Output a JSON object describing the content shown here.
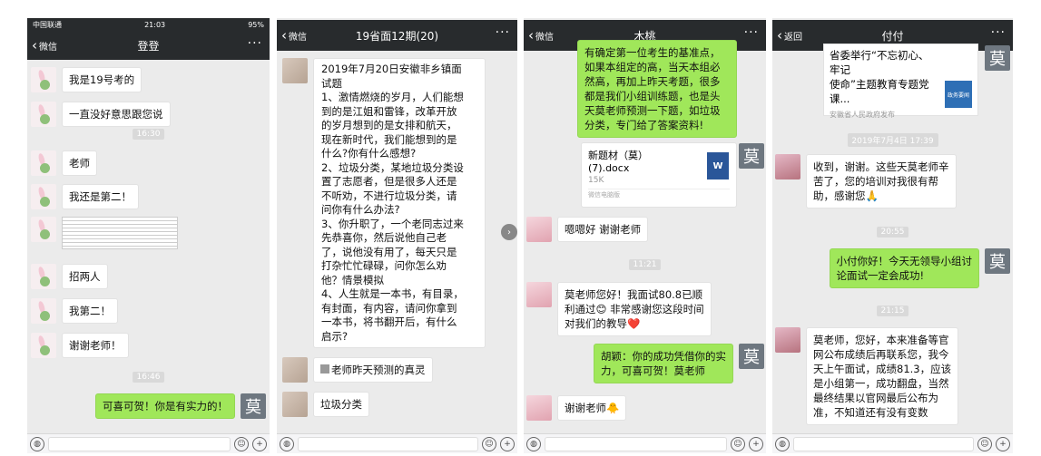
{
  "panel1": {
    "status": {
      "carrier": "中国联通",
      "time": "21:03",
      "battery": "95%"
    },
    "back_label": "微信",
    "title": "登登",
    "messages": [
      "我是19号考的",
      "一直没好意思跟您说",
      "老师",
      "我还是第二！",
      "招两人",
      "我第二！",
      "谢谢老师！"
    ],
    "times": [
      "16:30",
      "16:46"
    ],
    "reply": "可喜可贺！你是有实力的！",
    "avatar_char": "莫"
  },
  "panel2": {
    "back_label": "微信",
    "title": "19省面12期(20)",
    "question_lines": [
      "2019年7月20日安徽非乡镇面",
      "试题",
      "1、激情燃烧的岁月，人们能想",
      "到的是江姐和雷锋，改革开放",
      "的岁月想到的是女排和航天，",
      "现在新时代，我们能想到的是",
      "什么?你有什么感想?",
      "2、垃圾分类，某地垃圾分类设",
      "置了志愿者，但是很多人还是",
      "不听劝，不进行垃圾分类，请",
      "问你有什么办法?",
      "3、你升职了，一个老同志过来",
      "先恭喜你，然后说他自己老",
      "了，说他没有用了，每天只是",
      "打杂忙忙碌碌，问你怎么劝",
      "他？情景模拟",
      "4、人生就是一本书，有目录，",
      "有封面，有内容，请问你拿到",
      "一本书，将书翻开后，有什么",
      "启示?"
    ],
    "msg2": "老师昨天预测的真灵",
    "msg3": "垃圾分类"
  },
  "panel3": {
    "back_label": "微信",
    "title": "木桃",
    "green_lines": [
      "有确定第一位考生的基准点，",
      "如果本组定的高，当天本组必",
      "然高，再加上昨天考题，很多",
      "都是我们小组训练题，也是头",
      "天莫老师预测一下题，如垃圾",
      "分类，专门给了答案资料!"
    ],
    "file_name_1": "新题材（莫）",
    "file_name_2": "(7).docx",
    "file_size": "15K",
    "file_source": "微信电脑版",
    "file_icon": "W",
    "msg_thanks": "嗯嗯好 谢谢老师",
    "time": "11:21",
    "msg_score_lines": [
      "莫老师您好！我面试80.8已顺",
      "利通过😊 非常感谢您这段时间",
      "对我们的教导❤️"
    ],
    "reply_lines": [
      "胡颖：你的成功凭借你的实",
      "力，可喜可贺！莫老师"
    ],
    "msg_last": "谢谢老师🐥",
    "avatar_char": "莫"
  },
  "panel4": {
    "back_label": "返回",
    "title": "付付",
    "news_lines": [
      "省委举行“不忘初心、牢记",
      "使命”主题教育专题党课..."
    ],
    "news_source": "安徽省人民政府发布",
    "news_thumb": "政务要闻",
    "time1": "2019年7月4日 17:39",
    "msg1_lines": [
      "收到，谢谢。这些天莫老师辛",
      "苦了，您的培训对我很有帮",
      "助，感谢您🙏"
    ],
    "time2": "20:55",
    "reply_lines": [
      "小付你好！今天无领导小组讨",
      "论面试一定会成功!"
    ],
    "time3": "21:15",
    "msg2_lines": [
      "莫老师，您好，本来准备等官",
      "网公布成绩后再联系您，我今",
      "天上午面试，成绩81.3，应该",
      "是小组第一，成功翻盘，当然",
      "最终结果以官网最后公布为",
      "准，不知道还有没有变数"
    ],
    "avatar_char": "莫"
  },
  "colors": {
    "green_bubble": "#a0e75a",
    "title_bar": "#282b2d",
    "chat_bg": "#ebebeb"
  }
}
